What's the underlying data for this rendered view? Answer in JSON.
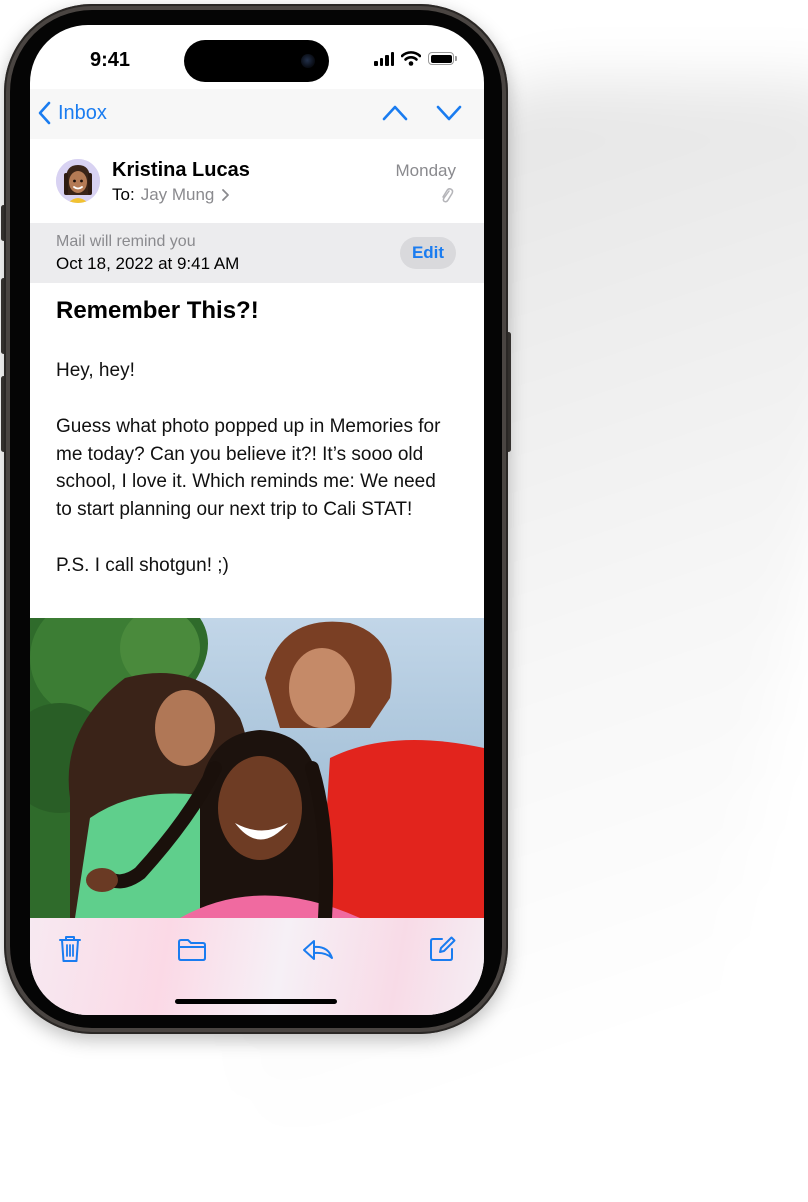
{
  "status_bar": {
    "time": "9:41"
  },
  "nav": {
    "back_label": "Inbox"
  },
  "message": {
    "sender": "Kristina Lucas",
    "to_label": "To:",
    "to_name": "Jay Mung",
    "date": "Monday",
    "subject": "Remember This?!",
    "greeting": "Hey, hey!",
    "paragraph": "Guess what photo popped up in Memories for me today? Can you believe it?! It’s sooo old school, I love it. Which reminds me: We need to start planning our next trip to Cali STAT!",
    "postscript": "P.S. I call shotgun! ;)"
  },
  "reminder": {
    "note": "Mail will remind you",
    "datetime": "Oct 18, 2022 at 9:41 AM",
    "edit_label": "Edit"
  },
  "colors": {
    "accent": "#1a7cf0",
    "secondary_text": "#8a8a8e"
  },
  "icons": {
    "back": "chevron-left-icon",
    "previous": "chevron-up-icon",
    "next": "chevron-down-icon",
    "attachment": "paperclip-icon",
    "trash": "trash-icon",
    "folder": "folder-icon",
    "reply": "reply-icon",
    "compose": "compose-icon"
  }
}
